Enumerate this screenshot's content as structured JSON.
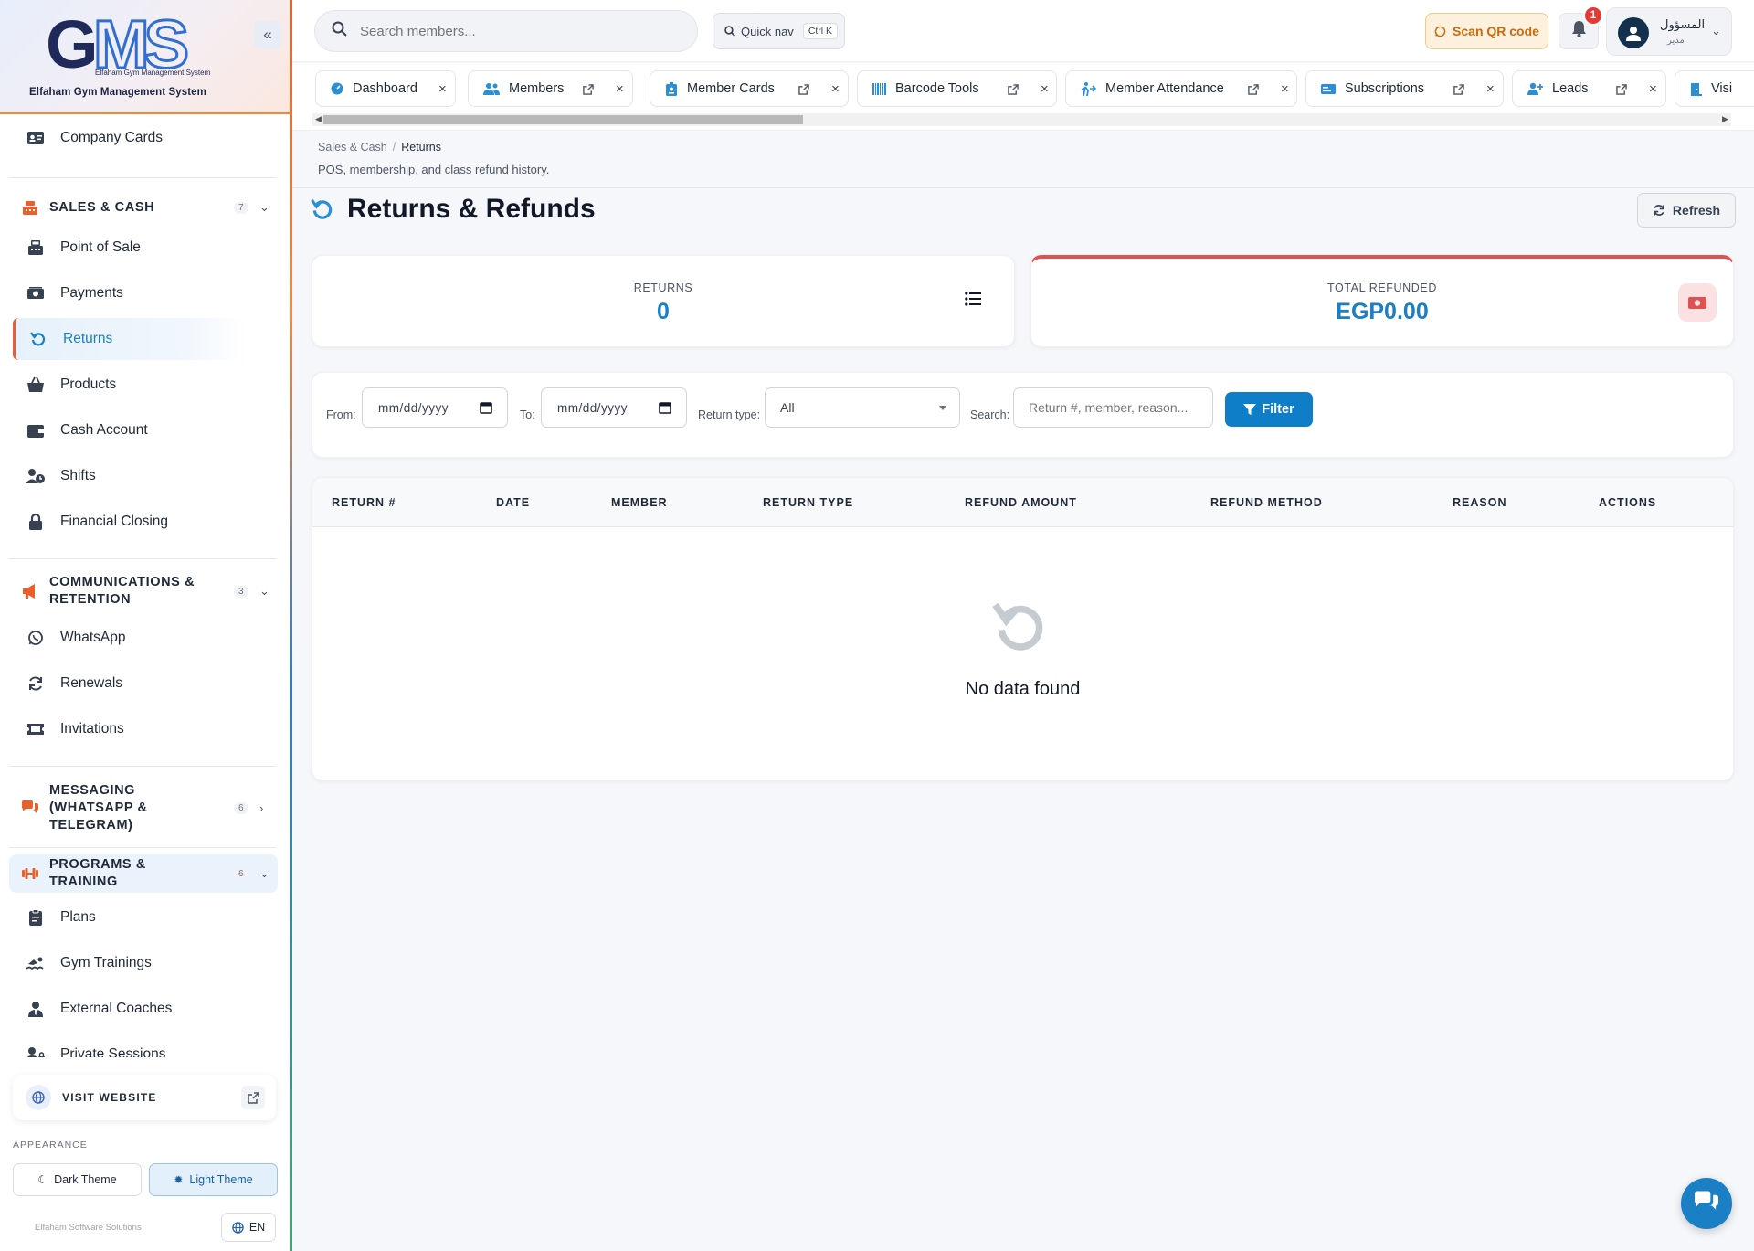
{
  "app": {
    "logo_text": "GMS",
    "logo_subtitle": "Elfaham Gym Management System",
    "title": "Elfaham Gym Management System"
  },
  "sidebar": {
    "top_item": {
      "label": "Company Cards",
      "icon": "id-card-icon"
    },
    "groups": [
      {
        "label": "SALES & CASH",
        "count": "7",
        "icon": "cash-register-icon",
        "expanded": true,
        "items": [
          {
            "label": "Point of Sale",
            "icon": "pos-terminal-icon"
          },
          {
            "label": "Payments",
            "icon": "money-bill-icon"
          },
          {
            "label": "Returns",
            "icon": "undo-icon",
            "active": true
          },
          {
            "label": "Products",
            "icon": "basket-icon"
          },
          {
            "label": "Cash Account",
            "icon": "wallet-icon"
          },
          {
            "label": "Shifts",
            "icon": "user-clock-icon"
          },
          {
            "label": "Financial Closing",
            "icon": "lock-icon"
          }
        ]
      },
      {
        "label": "COMMUNICATIONS & RETENTION",
        "count": "3",
        "icon": "megaphone-icon",
        "expanded": true,
        "items": [
          {
            "label": "WhatsApp",
            "icon": "whatsapp-icon"
          },
          {
            "label": "Renewals",
            "icon": "sync-icon"
          },
          {
            "label": "Invitations",
            "icon": "ticket-icon"
          }
        ]
      },
      {
        "label": "MESSAGING (WHATSAPP & TELEGRAM)",
        "count": "6",
        "icon": "comments-icon",
        "expanded": false,
        "items": []
      },
      {
        "label": "PROGRAMS & TRAINING",
        "count": "6",
        "icon": "dumbbell-icon",
        "expanded": true,
        "items": [
          {
            "label": "Plans",
            "icon": "clipboard-icon"
          },
          {
            "label": "Gym Trainings",
            "icon": "swimmer-icon"
          },
          {
            "label": "External Coaches",
            "icon": "user-tie-icon"
          },
          {
            "label": "Private Sessions",
            "icon": "user-lock-icon"
          }
        ]
      }
    ],
    "visit_website": "VISIT WEBSITE",
    "appearance_label": "APPEARANCE",
    "theme_dark": "Dark Theme",
    "theme_light": "Light Theme",
    "footer_brand": "Elfaham Software Solutions",
    "language": "EN"
  },
  "topbar": {
    "search_placeholder": "Search members...",
    "quick_nav": "Quick nav",
    "quick_nav_shortcut": "Ctrl K",
    "scan_qr": "Scan QR code",
    "notification_count": "1",
    "user_name": "المسؤول",
    "user_role": "مدير"
  },
  "tabs": [
    {
      "label": "Dashboard",
      "icon": "dashboard-icon"
    },
    {
      "label": "Members",
      "icon": "users-icon"
    },
    {
      "label": "Member Cards",
      "icon": "id-badge-icon"
    },
    {
      "label": "Barcode Tools",
      "icon": "barcode-icon"
    },
    {
      "label": "Member Attendance",
      "icon": "walking-icon"
    },
    {
      "label": "Subscriptions",
      "icon": "card-icon"
    },
    {
      "label": "Leads",
      "icon": "user-plus-icon"
    },
    {
      "label": "Visi",
      "icon": "door-icon"
    }
  ],
  "breadcrumb": {
    "parent": "Sales & Cash",
    "current": "Returns"
  },
  "page": {
    "description": "POS, membership, and class refund history.",
    "title": "Returns & Refunds",
    "refresh": "Refresh"
  },
  "stats": {
    "returns_label": "RETURNS",
    "returns_value": "0",
    "refunded_label": "TOTAL REFUNDED",
    "refunded_value": "EGP0.00"
  },
  "filters": {
    "from_label": "From:",
    "from_value": "mm/dd/yyyy",
    "to_label": "To:",
    "to_value": "mm/dd/yyyy",
    "type_label": "Return type:",
    "type_value": "All",
    "search_label": "Search:",
    "search_placeholder": "Return #, member, reason...",
    "filter_button": "Filter"
  },
  "table": {
    "columns": [
      "RETURN #",
      "DATE",
      "MEMBER",
      "RETURN TYPE",
      "REFUND AMOUNT",
      "REFUND METHOD",
      "REASON",
      "ACTIONS"
    ],
    "rows": [],
    "empty_text": "No data found"
  },
  "colors": {
    "accent": "#1a7fc4",
    "brand_orange": "#e8612c",
    "danger": "#e05252"
  }
}
